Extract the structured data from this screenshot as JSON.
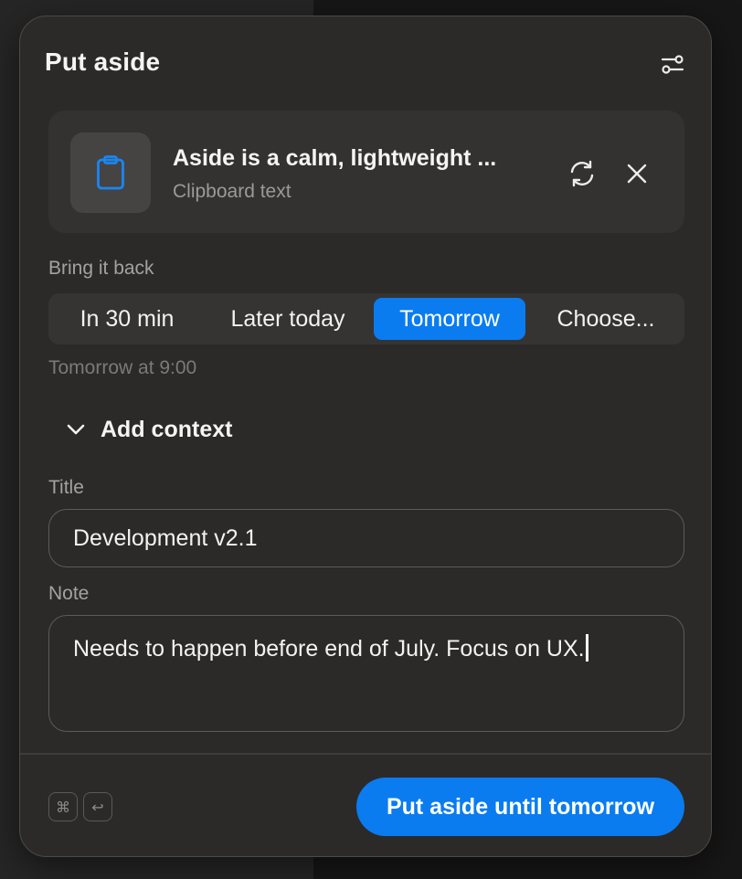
{
  "header": {
    "title": "Put aside",
    "settings_icon": "sliders-icon"
  },
  "item": {
    "icon": "clipboard-icon",
    "title": "Aside is a calm, lightweight ...",
    "subtitle": "Clipboard text",
    "refresh_icon": "refresh-icon",
    "close_icon": "close-icon"
  },
  "bring_back": {
    "label": "Bring it back",
    "options": [
      {
        "label": "In 30 min",
        "active": false
      },
      {
        "label": "Later today",
        "active": false
      },
      {
        "label": "Tomorrow",
        "active": true
      },
      {
        "label": "Choose...",
        "active": false
      }
    ],
    "hint": "Tomorrow at 9:00"
  },
  "context": {
    "toggle_label": "Add context",
    "toggle_icon": "chevron-down-icon"
  },
  "title_field": {
    "label": "Title",
    "value": "Development v2.1"
  },
  "note_field": {
    "label": "Note",
    "value": "Needs to happen before end of July. Focus on UX."
  },
  "footer": {
    "shortcut_keys": [
      "⌘",
      "↩"
    ],
    "primary_label": "Put aside until tomorrow"
  },
  "colors": {
    "accent": "#0a7cf0",
    "panel": "#2b2a29"
  }
}
